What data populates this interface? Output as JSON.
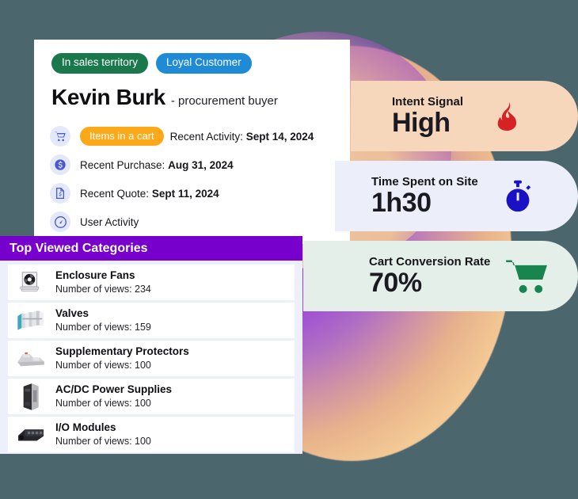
{
  "background": {
    "canvas_color": "#4c666e",
    "blob_colors": [
      "#8a2be2",
      "#b06ec4",
      "#e8b28c",
      "#f6d9ae"
    ]
  },
  "contact_card": {
    "badges": [
      {
        "label": "In sales territory",
        "color": "#19794c"
      },
      {
        "label": "Loyal Customer",
        "color": "#1f8ad6"
      }
    ],
    "name": "Kevin Burk",
    "role": "- procurement buyer",
    "activity": [
      {
        "icon": "shopping-cart-icon",
        "pill": "Items in a cart",
        "pill_color": "#fba919",
        "label": "Recent Activity:",
        "value": "Sept 14, 2024"
      },
      {
        "icon": "dollar-circle-icon",
        "pill": null,
        "label": "Recent Purchase:",
        "value": "Aug 31, 2024"
      },
      {
        "icon": "quote-document-icon",
        "pill": null,
        "label": "Recent Quote:",
        "value": "Sept 11, 2024"
      },
      {
        "icon": "speedometer-icon",
        "pill": null,
        "label": "User Activity",
        "value": ""
      }
    ]
  },
  "categories_panel": {
    "title": "Top Viewed Categories",
    "header_color": "#7700cc",
    "items": [
      {
        "name": "Enclosure Fans",
        "views": "Number of views: 234",
        "thumb": "enclosure-fan-thumb"
      },
      {
        "name": "Valves",
        "views": "Number of views: 159",
        "thumb": "valve-thumb"
      },
      {
        "name": "Supplementary Protectors",
        "views": "Number of views: 100",
        "thumb": "protector-thumb"
      },
      {
        "name": "AC/DC Power Supplies",
        "views": "Number of views: 100",
        "thumb": "power-supply-thumb"
      },
      {
        "name": "I/O Modules",
        "views": "Number of views: 100",
        "thumb": "io-module-thumb"
      }
    ]
  },
  "stats": [
    {
      "label": "Intent Signal",
      "value": "High",
      "icon": "flame-icon",
      "bg": "#f6d7bb",
      "icon_color": "#d62222"
    },
    {
      "label": "Time Spent on Site",
      "value": "1h30",
      "icon": "stopwatch-icon",
      "bg": "#eceefa",
      "icon_color": "#1a11c4"
    },
    {
      "label": "Cart Conversion Rate",
      "value": "70%",
      "icon": "cart-icon",
      "bg": "#e4efe9",
      "icon_color": "#18854f"
    }
  ]
}
